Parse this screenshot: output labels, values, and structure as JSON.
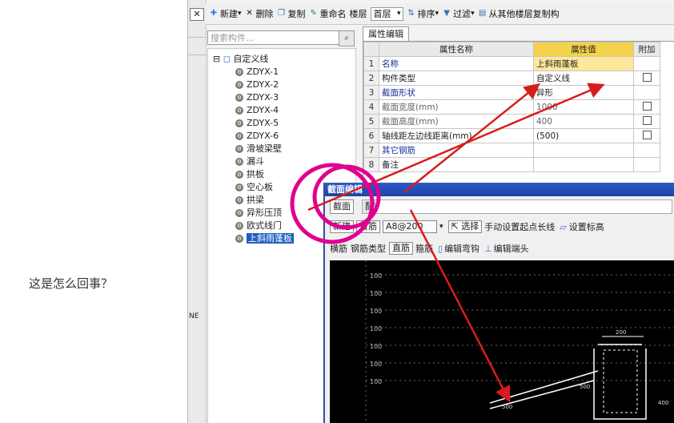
{
  "question": "这是怎么回事？",
  "toolbar": {
    "items": [
      {
        "label": "新建",
        "icon": "new-icon",
        "dropdown": true
      },
      {
        "label": "删除",
        "icon": "delete-icon"
      },
      {
        "label": "复制",
        "icon": "copy-icon"
      },
      {
        "label": "重命名",
        "icon": "rename-icon"
      },
      {
        "label": "楼层",
        "icon": ""
      },
      {
        "label": "排序",
        "icon": "sort-icon",
        "dropdown": true
      },
      {
        "label": "过滤",
        "icon": "filter-icon",
        "dropdown": true
      },
      {
        "label": "从其他楼层复制构",
        "icon": "copy-floor-icon"
      }
    ],
    "floor_value": "首层"
  },
  "left_strip": {
    "close": "✕",
    "edge_text": "NE"
  },
  "search": {
    "placeholder": "搜索构件..."
  },
  "tree": {
    "root": "自定义线",
    "items": [
      "ZDYX-1",
      "ZDYX-2",
      "ZDYX-3",
      "ZDYX-4",
      "ZDYX-5",
      "ZDYX-6",
      "滑坡梁壁",
      "漏斗",
      "拱板",
      "空心板",
      "拱梁",
      "异形压顶",
      "欧式线门",
      "上斜雨蓬板"
    ],
    "selected_index": 13
  },
  "props": {
    "tab": "属性编辑",
    "headers": {
      "name": "属性名称",
      "value": "属性值",
      "extra": "附加"
    },
    "rows": [
      {
        "n": "1",
        "name": "名称",
        "value": "上斜雨蓬板",
        "check": false,
        "blue": true
      },
      {
        "n": "2",
        "name": "构件类型",
        "value": "自定义线",
        "check": true,
        "blue": false
      },
      {
        "n": "3",
        "name": "截面形状",
        "value": "异形",
        "check": false,
        "blue": true
      },
      {
        "n": "4",
        "name": "截面宽度(mm)",
        "value": "1000",
        "check": true,
        "blue": false
      },
      {
        "n": "5",
        "name": "截面高度(mm)",
        "value": "400",
        "check": true,
        "blue": false
      },
      {
        "n": "6",
        "name": "轴线距左边线距离(mm)",
        "value": "(500)",
        "check": true,
        "blue": false
      },
      {
        "n": "7",
        "name": "其它钢筋",
        "value": "",
        "check": false,
        "blue": true
      },
      {
        "n": "8",
        "name": "备注",
        "value": "",
        "check": false,
        "blue": false
      }
    ]
  },
  "dialog": {
    "title": "截面编辑",
    "tabs": [
      "截面",
      "配筋"
    ],
    "row1": [
      "新建",
      "首筋",
      "A8@200",
      "选择",
      "手动设置起点长线",
      "设置标高"
    ],
    "row2": [
      "横筋",
      "钢筋类型",
      "直筋",
      "箍筋",
      "编辑弯钩",
      "编辑端头"
    ]
  },
  "canvas": {
    "axis_labels": [
      "100",
      "100",
      "100",
      "100",
      "100",
      "100",
      "100"
    ],
    "dims": [
      "200",
      "500",
      "400",
      "500"
    ]
  },
  "colors": {
    "accent": "#e00090",
    "arrow": "#d81c1c",
    "selection": "#1f5fbf",
    "title_bar": "#2a58c8"
  }
}
